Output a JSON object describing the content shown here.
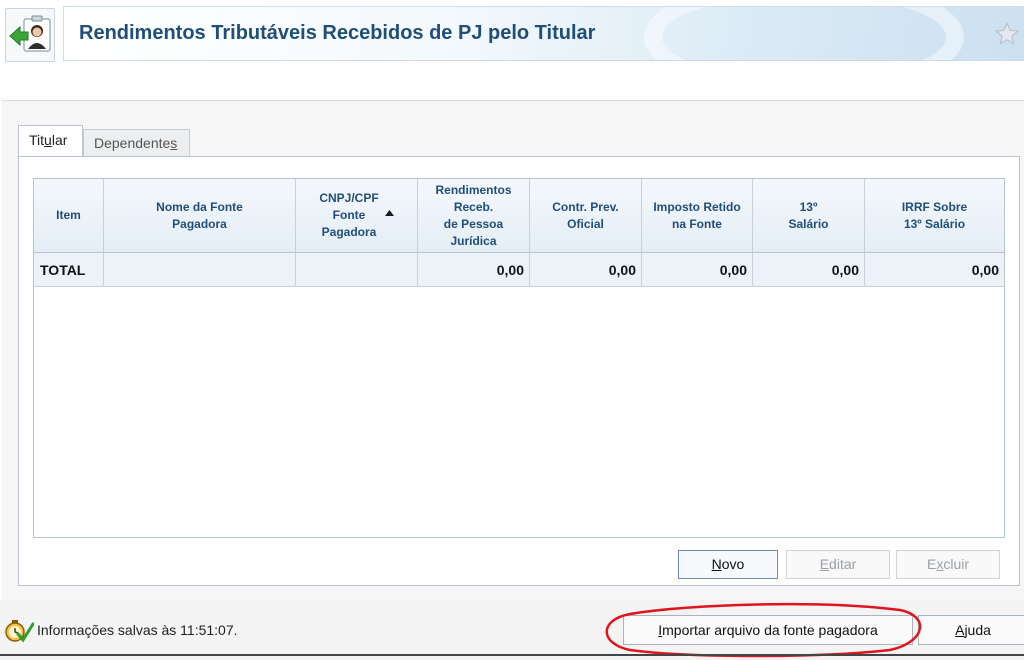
{
  "header": {
    "title": "Rendimentos Tributáveis Recebidos de PJ pelo Titular",
    "back_icon": "back-arrow-person-icon",
    "favorite_icon": "star-icon"
  },
  "tabs": [
    {
      "pre": "Tit",
      "key": "u",
      "post": "lar",
      "selected": true
    },
    {
      "pre": "Dependente",
      "key": "s",
      "post": "",
      "selected": false
    }
  ],
  "table": {
    "columns": [
      {
        "lines": [
          "Item"
        ]
      },
      {
        "lines": [
          "Nome da Fonte",
          "Pagadora"
        ]
      },
      {
        "lines": [
          "CNPJ/CPF",
          "Fonte",
          "Pagadora"
        ],
        "sorted": "asc"
      },
      {
        "lines": [
          "Rendimentos",
          "Receb.",
          "de Pessoa",
          "Jurídica"
        ]
      },
      {
        "lines": [
          "Contr. Prev.",
          "Oficial"
        ]
      },
      {
        "lines": [
          "Imposto Retido",
          "na Fonte"
        ]
      },
      {
        "lines": [
          "13º",
          "Salário"
        ]
      },
      {
        "lines": [
          "IRRF Sobre",
          "13º Salário"
        ]
      }
    ],
    "total_row": [
      "TOTAL",
      "",
      "",
      "0,00",
      "0,00",
      "0,00",
      "0,00",
      "0,00"
    ]
  },
  "buttons": {
    "novo": {
      "pre": "",
      "key": "N",
      "post": "ovo",
      "enabled": true
    },
    "editar": {
      "pre": "",
      "key": "E",
      "post": "ditar",
      "enabled": false
    },
    "excluir": {
      "pre": "E",
      "key": "x",
      "post": "cluir",
      "enabled": false
    }
  },
  "footer": {
    "status_icon": "saved-clock-check-icon",
    "status": "Informações salvas às 11:51:07.",
    "import_button": {
      "pre": "",
      "key": "I",
      "post": "mportar arquivo da fonte pagadora"
    },
    "help_button": {
      "pre": "",
      "key": "A",
      "post": "juda"
    }
  },
  "colors": {
    "title": "#1f4e79",
    "header_text": "#1f4e79",
    "annotation": "#e0141e"
  }
}
